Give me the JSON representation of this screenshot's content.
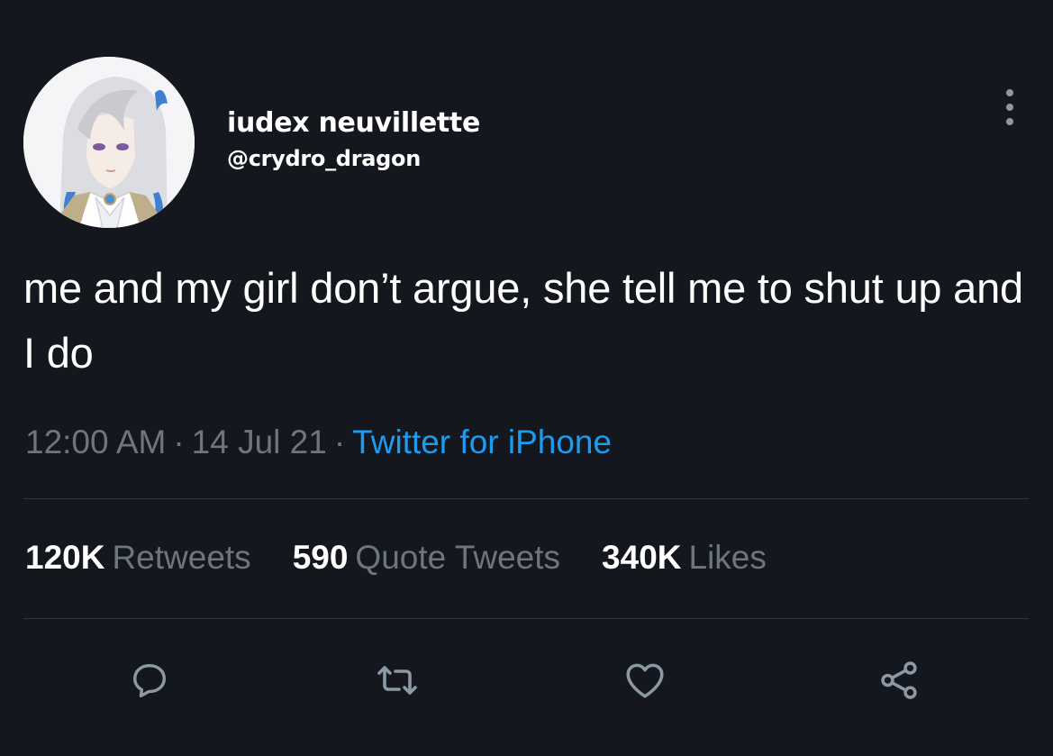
{
  "author": {
    "display_name": "iudex neuvillette",
    "handle": "@crydro_dragon",
    "avatar_icon": "avatar-portrait"
  },
  "tweet": {
    "text": "me and my girl don’t argue, she tell me to shut up and I do",
    "time": "12:00 AM",
    "date": "14 Jul 21",
    "separator": "·",
    "source": "Twitter for iPhone"
  },
  "stats": {
    "retweets": {
      "count": "120K",
      "label": "Retweets"
    },
    "quotes": {
      "count": "590",
      "label": "Quote Tweets"
    },
    "likes": {
      "count": "340K",
      "label": "Likes"
    }
  },
  "actions": {
    "reply_icon": "reply-icon",
    "retweet_icon": "retweet-icon",
    "like_icon": "heart-icon",
    "share_icon": "share-icon",
    "more_icon": "more-vertical-icon"
  },
  "colors": {
    "background": "#14171d",
    "text": "#ffffff",
    "muted": "#6e767d",
    "link": "#1d9bf0",
    "icon": "#8b98a5",
    "divider": "#2f3336"
  }
}
